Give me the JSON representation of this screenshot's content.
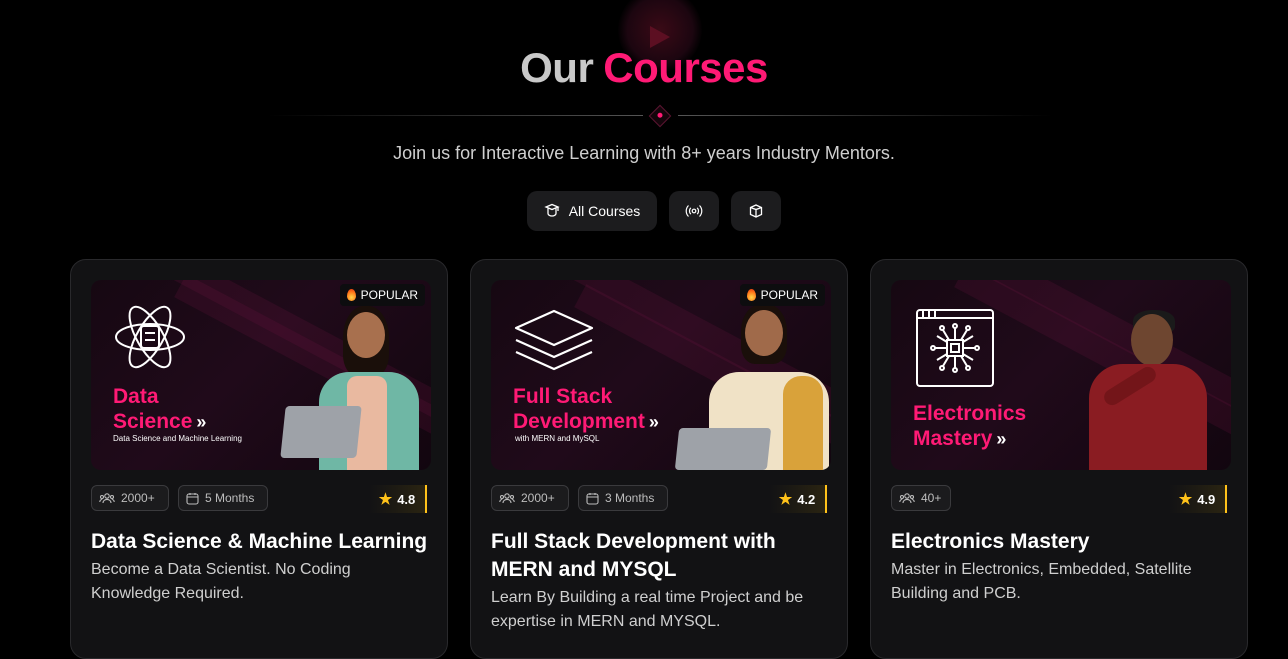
{
  "header": {
    "title_part1": "Our",
    "title_part2": "Courses",
    "subtitle": "Join us for Interactive Learning with 8+ years Industry Mentors."
  },
  "tabs": [
    {
      "label": "All Courses",
      "icon": "graduation-icon"
    },
    {
      "label": "",
      "icon": "live-broadcast-icon"
    },
    {
      "label": "",
      "icon": "box-icon"
    }
  ],
  "courses": [
    {
      "badge": "POPULAR",
      "banner_title_line1": "Data",
      "banner_title_line2": "Science",
      "banner_arrow": "»",
      "banner_subtitle": "Data Science and Machine Learning",
      "students": "2000+",
      "duration": "5 Months",
      "rating": "4.8",
      "title": "Data Science & Machine Learning",
      "description": "Become a Data Scientist. No Coding Knowledge Required."
    },
    {
      "badge": "POPULAR",
      "banner_title_line1": "Full Stack",
      "banner_title_line2": "Development",
      "banner_arrow": "»",
      "banner_subtitle": "with MERN and MySQL",
      "students": "2000+",
      "duration": "3 Months",
      "rating": "4.2",
      "title": "Full Stack Development with MERN and MYSQL",
      "description": "Learn By Building a real time Project and be expertise in MERN and MYSQL."
    },
    {
      "badge": "",
      "banner_title_line1": "Electronics",
      "banner_title_line2": "Mastery",
      "banner_arrow": "»",
      "banner_subtitle": "",
      "students": "40+",
      "duration": "",
      "rating": "4.9",
      "title": "Electronics Mastery",
      "description": "Master in Electronics, Embedded, Satellite Building and PCB."
    }
  ],
  "colors": {
    "accent": "#ff1a75",
    "star": "#ffc21a",
    "background": "#000000",
    "card": "#121214"
  }
}
